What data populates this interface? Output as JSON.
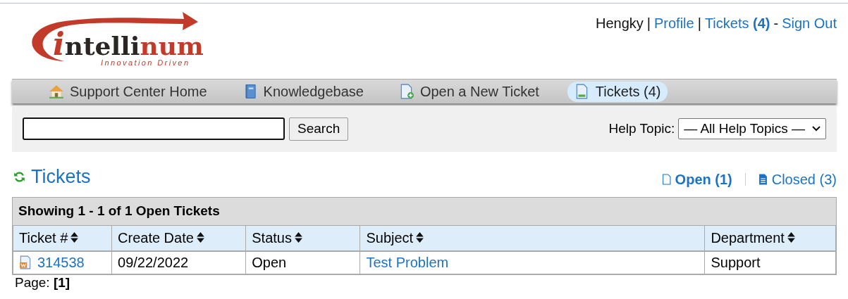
{
  "logo": {
    "segments": [
      {
        "text": "i",
        "color": "#c23b2a"
      },
      {
        "text": "ntelli",
        "color": "#2b2524"
      },
      {
        "text": "num",
        "color": "#c23b2a"
      }
    ],
    "tagline": "Innovation Driven"
  },
  "user_bar": [
    {
      "kind": "text",
      "text": "Hengky"
    },
    {
      "kind": "sep",
      "text": "|"
    },
    {
      "kind": "link",
      "text": "Profile"
    },
    {
      "kind": "sep",
      "text": "|"
    },
    {
      "kind": "link",
      "text": "Tickets **(4)**"
    },
    {
      "kind": "dash",
      "text": "-"
    },
    {
      "kind": "link",
      "text": "Sign Out"
    }
  ],
  "nav": [
    {
      "label": "Support Center Home",
      "kind": "home",
      "selected": false
    },
    {
      "label": "Knowledgebase",
      "kind": "book",
      "selected": false
    },
    {
      "label": "Open a New Ticket",
      "kind": "newdoc",
      "selected": false
    },
    {
      "label": "Tickets (4)",
      "kind": "doc",
      "selected": true
    }
  ],
  "search": {
    "button": "Search",
    "topic_label": "Help Topic:",
    "topic_value": "— All Help Topics —"
  },
  "heading": "Tickets",
  "filters": [
    {
      "label": "Open (1)",
      "kind": "outline",
      "selected": true
    },
    {
      "label": "Closed (3)",
      "kind": "filled",
      "selected": false
    }
  ],
  "table": {
    "caption": "Showing 1 - 1 of 1 Open Tickets",
    "columns": [
      "Ticket #",
      "Create Date",
      "Status",
      "Subject",
      "Department"
    ],
    "rows": [
      {
        "ticket": "314538",
        "date": "09/22/2022",
        "status": "Open",
        "subject": "Test Problem",
        "department": "Support"
      }
    ]
  },
  "pager": "Page: **[1]**"
}
